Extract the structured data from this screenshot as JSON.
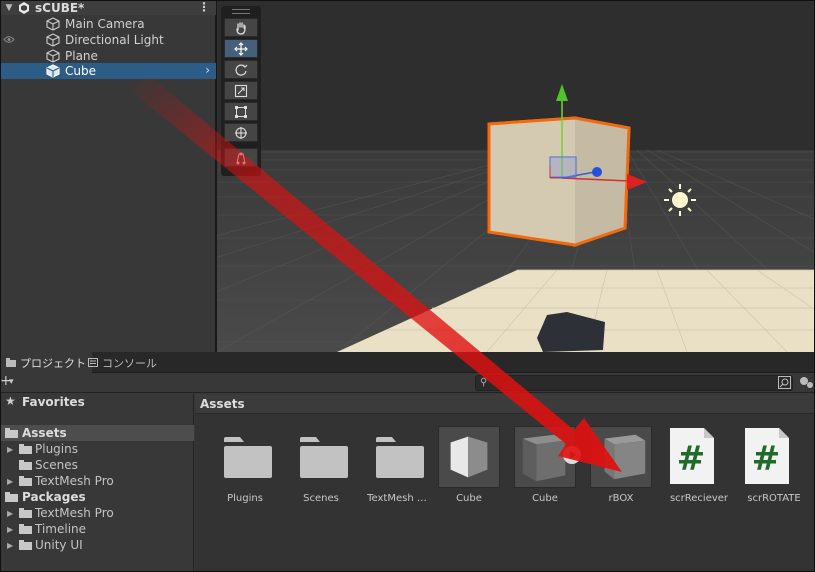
{
  "hierarchy": {
    "scene_name": "sCUBE*",
    "items": [
      {
        "label": "Main Camera"
      },
      {
        "label": "Directional Light"
      },
      {
        "label": "Plane"
      },
      {
        "label": "Cube",
        "selected": true
      }
    ]
  },
  "scene_tools": {
    "icons": [
      "hand-icon",
      "move-icon",
      "rotate-icon",
      "scale-icon",
      "rect-icon",
      "transform-icon",
      "custom-tool-icon"
    ],
    "active_tool": "move-icon"
  },
  "bottom_panel": {
    "tabs": [
      {
        "label": "プロジェクト",
        "active": true
      },
      {
        "label": "コンソール",
        "active": false
      }
    ],
    "search": {
      "value": "",
      "placeholder": ""
    },
    "tree": {
      "favorites_label": "Favorites",
      "assets_label": "Assets",
      "asset_children": [
        "Plugins",
        "Scenes",
        "TextMesh Pro"
      ],
      "packages_label": "Packages",
      "package_children": [
        "TextMesh Pro",
        "Timeline",
        "Unity UI"
      ]
    },
    "assets_header": "Assets",
    "assets": [
      {
        "label": "Plugins",
        "kind": "folder"
      },
      {
        "label": "Scenes",
        "kind": "folder"
      },
      {
        "label": "TextMesh …",
        "kind": "folder"
      },
      {
        "label": "Cube",
        "kind": "material"
      },
      {
        "label": "Cube",
        "kind": "prefab"
      },
      {
        "label": "rBOX",
        "kind": "prefab"
      },
      {
        "label": "scrReciever",
        "kind": "script"
      },
      {
        "label": "scrROTATE",
        "kind": "script"
      }
    ],
    "script_symbol": "#"
  },
  "colors": {
    "selection": "#2c5d87",
    "arrow": "#e01010",
    "outline": "#f07020",
    "script_hash": "#1f6b2a"
  }
}
